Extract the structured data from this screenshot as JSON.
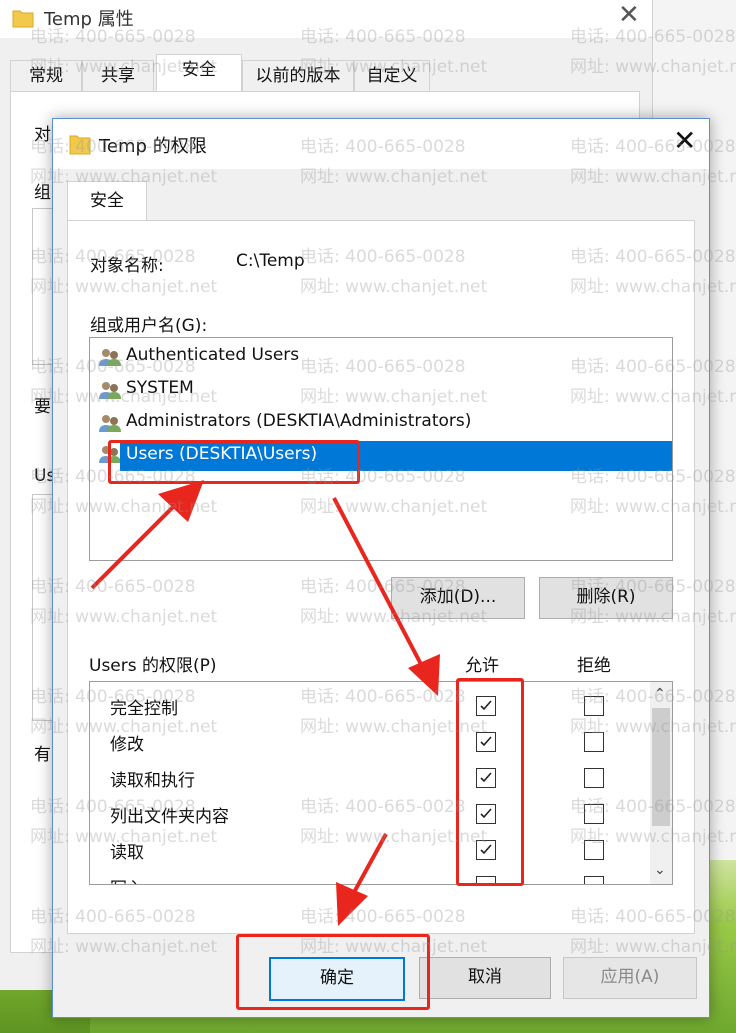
{
  "back_dialog": {
    "title": "Temp 属性",
    "tabs": [
      "常规",
      "共享",
      "安全",
      "以前的版本",
      "自定义"
    ],
    "active_tab": "安全",
    "fragments": [
      "对",
      "组",
      "要",
      "Us",
      "有"
    ]
  },
  "dialog": {
    "title": "Temp 的权限",
    "tab": "安全",
    "object_name_label": "对象名称:",
    "object_name_value": "C:\\Temp",
    "group_label": "组或用户名(G):",
    "users": [
      "Authenticated Users",
      "SYSTEM",
      "Administrators (DESKTIA\\Administrators)",
      "Users (DESKTIA\\Users)"
    ],
    "selected_user_index": 3,
    "add_button": "添加(D)...",
    "remove_button": "删除(R)",
    "perm_label": "Users 的权限(P)",
    "allow_header": "允许",
    "deny_header": "拒绝",
    "permissions": [
      {
        "name": "完全控制",
        "allow": true,
        "deny": false
      },
      {
        "name": "修改",
        "allow": true,
        "deny": false
      },
      {
        "name": "读取和执行",
        "allow": true,
        "deny": false
      },
      {
        "name": "列出文件夹内容",
        "allow": true,
        "deny": false
      },
      {
        "name": "读取",
        "allow": true,
        "deny": false
      },
      {
        "name": "写入",
        "allow": false,
        "deny": false
      }
    ],
    "ok_button": "确定",
    "cancel_button": "取消",
    "apply_button": "应用(A)"
  },
  "watermark": {
    "phone": "电话: 400-665-0028",
    "site": "网址: www.chanjet.net"
  },
  "colors": {
    "selection": "#0078d7",
    "annotation": "#e8261e"
  }
}
